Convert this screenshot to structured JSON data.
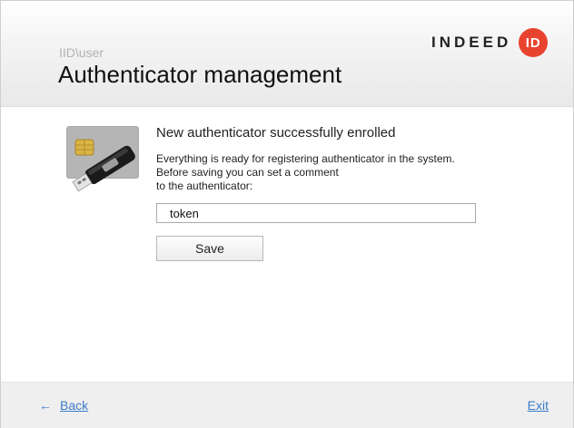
{
  "header": {
    "user_path": "IID\\user",
    "title": "Authenticator management",
    "logo_text": "INDEED",
    "logo_badge": "ID",
    "logo_accent": "#e8432e"
  },
  "main": {
    "authenticator_icon": "smartcard-usb-token-icon",
    "message_title": "New authenticator successfully enrolled",
    "message_lines": [
      "Everything is ready for registering authenticator in the system.",
      "Before saving you can set a comment",
      "to the authenticator:"
    ],
    "comment_value": "token",
    "save_label": "Save"
  },
  "footer": {
    "back_label": "Back",
    "back_icon": "left-arrow-icon",
    "exit_label": "Exit",
    "link_color": "#3a7bc8"
  }
}
